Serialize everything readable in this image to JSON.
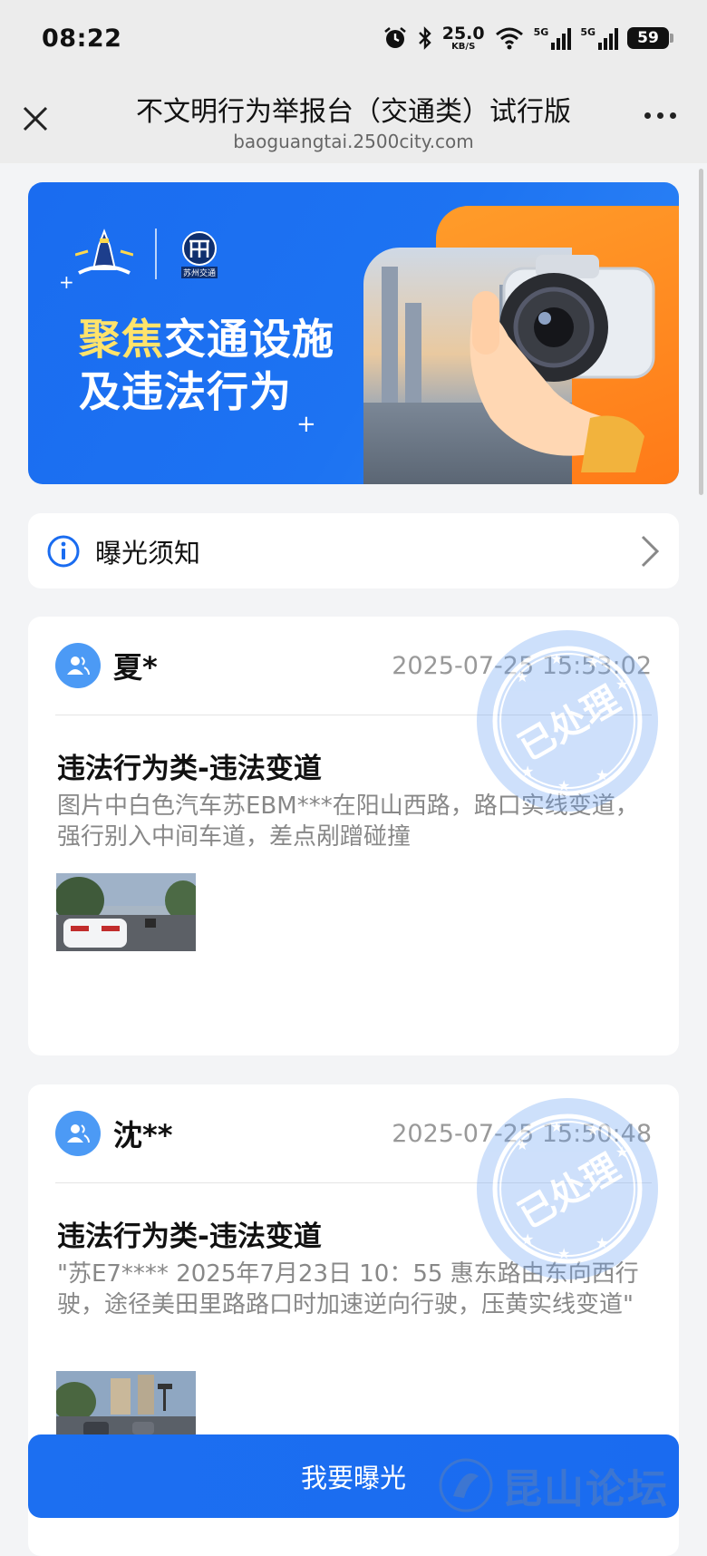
{
  "status_bar": {
    "time": "08:22",
    "net_speed_value": "25.0",
    "net_speed_unit": "KB/S",
    "signal1_label": "5G",
    "signal2_label": "5G",
    "battery": "59"
  },
  "nav": {
    "title": "不文明行为举报台（交通类）试行版",
    "domain": "baoguangtai.2500city.com"
  },
  "banner": {
    "slogan_highlight": "聚焦",
    "slogan_rest": "交通设施",
    "slogan_line2": "及违法行为",
    "logo2_caption": "苏州交通"
  },
  "notice": {
    "label": "曝光须知"
  },
  "reports": [
    {
      "name": "夏*",
      "time": "2025-07-25 15:53:02",
      "category": "违法行为类-违法变道",
      "description": "图片中白色汽车苏EBM***在阳山西路，路口实线变道，强行别入中间车道，差点剐蹭碰撞",
      "stamp_text": "已处理"
    },
    {
      "name": "沈**",
      "time": "2025-07-25 15:50:48",
      "category": "违法行为类-违法变道",
      "description": "\"苏E7**** 2025年7月23日 10：55 惠东路由东向西行驶，途径美田里路路口时加速逆向行驶，压黄实线变道\"",
      "stamp_text": "已处理"
    }
  ],
  "bottom": {
    "expose_button": "我要曝光",
    "watermark": "昆山论坛"
  },
  "colors": {
    "primary": "#1a6cf0",
    "accent_orange": "#ff8a1e",
    "stamp_blue": "#3d86ef"
  }
}
